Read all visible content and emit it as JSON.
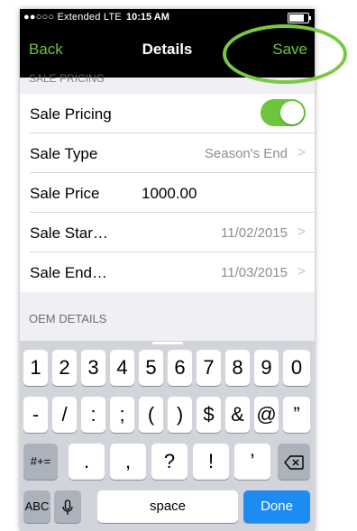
{
  "status_bar": {
    "carrier": "●●○○○ Extended  LTE",
    "time": "10:15 AM"
  },
  "nav": {
    "back": "Back",
    "title": "Details",
    "save": "Save"
  },
  "section_cut_title": "SALE PRICING",
  "rows": [
    {
      "label": "Sale Pricing",
      "toggle_on": true
    },
    {
      "label": "Sale Type",
      "value": "Season's End"
    },
    {
      "label": "Sale Price",
      "input_value": "1000.00"
    },
    {
      "label": "Sale Star…",
      "value": "11/02/2015"
    },
    {
      "label": "Sale End…",
      "value": "11/03/2015"
    }
  ],
  "oem_header": "OEM DETAILS",
  "keyboard": {
    "row1": [
      "1",
      "2",
      "3",
      "4",
      "5",
      "6",
      "7",
      "8",
      "9",
      "0"
    ],
    "row2": [
      "-",
      "/",
      ":",
      ";",
      "(",
      ")",
      "$",
      "&",
      "@",
      "”"
    ],
    "row3": {
      "mode": "#+=",
      "keys": [
        ".",
        ",",
        "?",
        "!",
        "’"
      ],
      "delete_icon": "backspace-icon"
    },
    "row4": {
      "abc": "ABC",
      "mic_icon": "microphone-icon",
      "space": "space",
      "done": "Done"
    }
  },
  "colors": {
    "accent": "#6cc53a",
    "done_blue": "#1d8cf2",
    "annotation_green": "#7ac943"
  }
}
